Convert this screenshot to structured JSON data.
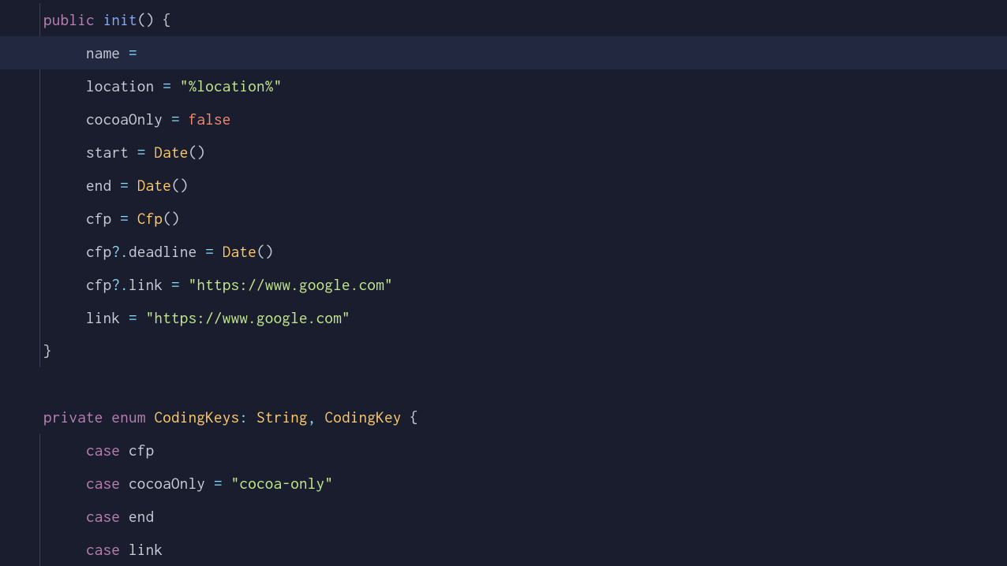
{
  "code": {
    "l1": {
      "kw1": "public",
      "kw2": "init",
      "paren": "()",
      "brace": " {"
    },
    "l2": {
      "prop": "name",
      "eq": " = "
    },
    "l3": {
      "prop": "location",
      "eq": " = ",
      "str": "\"%location%\""
    },
    "l4": {
      "prop": "cocoaOnly",
      "eq": " = ",
      "val": "false"
    },
    "l5": {
      "prop": "start",
      "eq": " = ",
      "type": "Date",
      "paren": "()"
    },
    "l6": {
      "prop": "end",
      "eq": " = ",
      "type": "Date",
      "paren": "()"
    },
    "l7": {
      "prop": "cfp",
      "eq": " = ",
      "type": "Cfp",
      "paren": "()"
    },
    "l8": {
      "prop1": "cfp",
      "opt": "?.",
      "prop2": "deadline",
      "eq": " = ",
      "type": "Date",
      "paren": "()"
    },
    "l9": {
      "prop1": "cfp",
      "opt": "?.",
      "prop2": "link",
      "eq": " = ",
      "str": "\"https://www.google.com\""
    },
    "l10": {
      "prop": "link",
      "eq": " = ",
      "str": "\"https://www.google.com\""
    },
    "l11": {
      "brace": "}"
    },
    "l13": {
      "kw1": "private",
      "kw2": "enum",
      "type1": "CodingKeys",
      "colon": ": ",
      "type2": "String",
      "comma": ", ",
      "type3": "CodingKey",
      "brace": " {"
    },
    "l14": {
      "kw": "case",
      "ident": " cfp"
    },
    "l15": {
      "kw": "case",
      "ident": " cocoaOnly",
      "eq": " = ",
      "str": "\"cocoa-only\""
    },
    "l16": {
      "kw": "case",
      "ident": " end"
    },
    "l17": {
      "kw": "case",
      "ident": " link"
    }
  }
}
